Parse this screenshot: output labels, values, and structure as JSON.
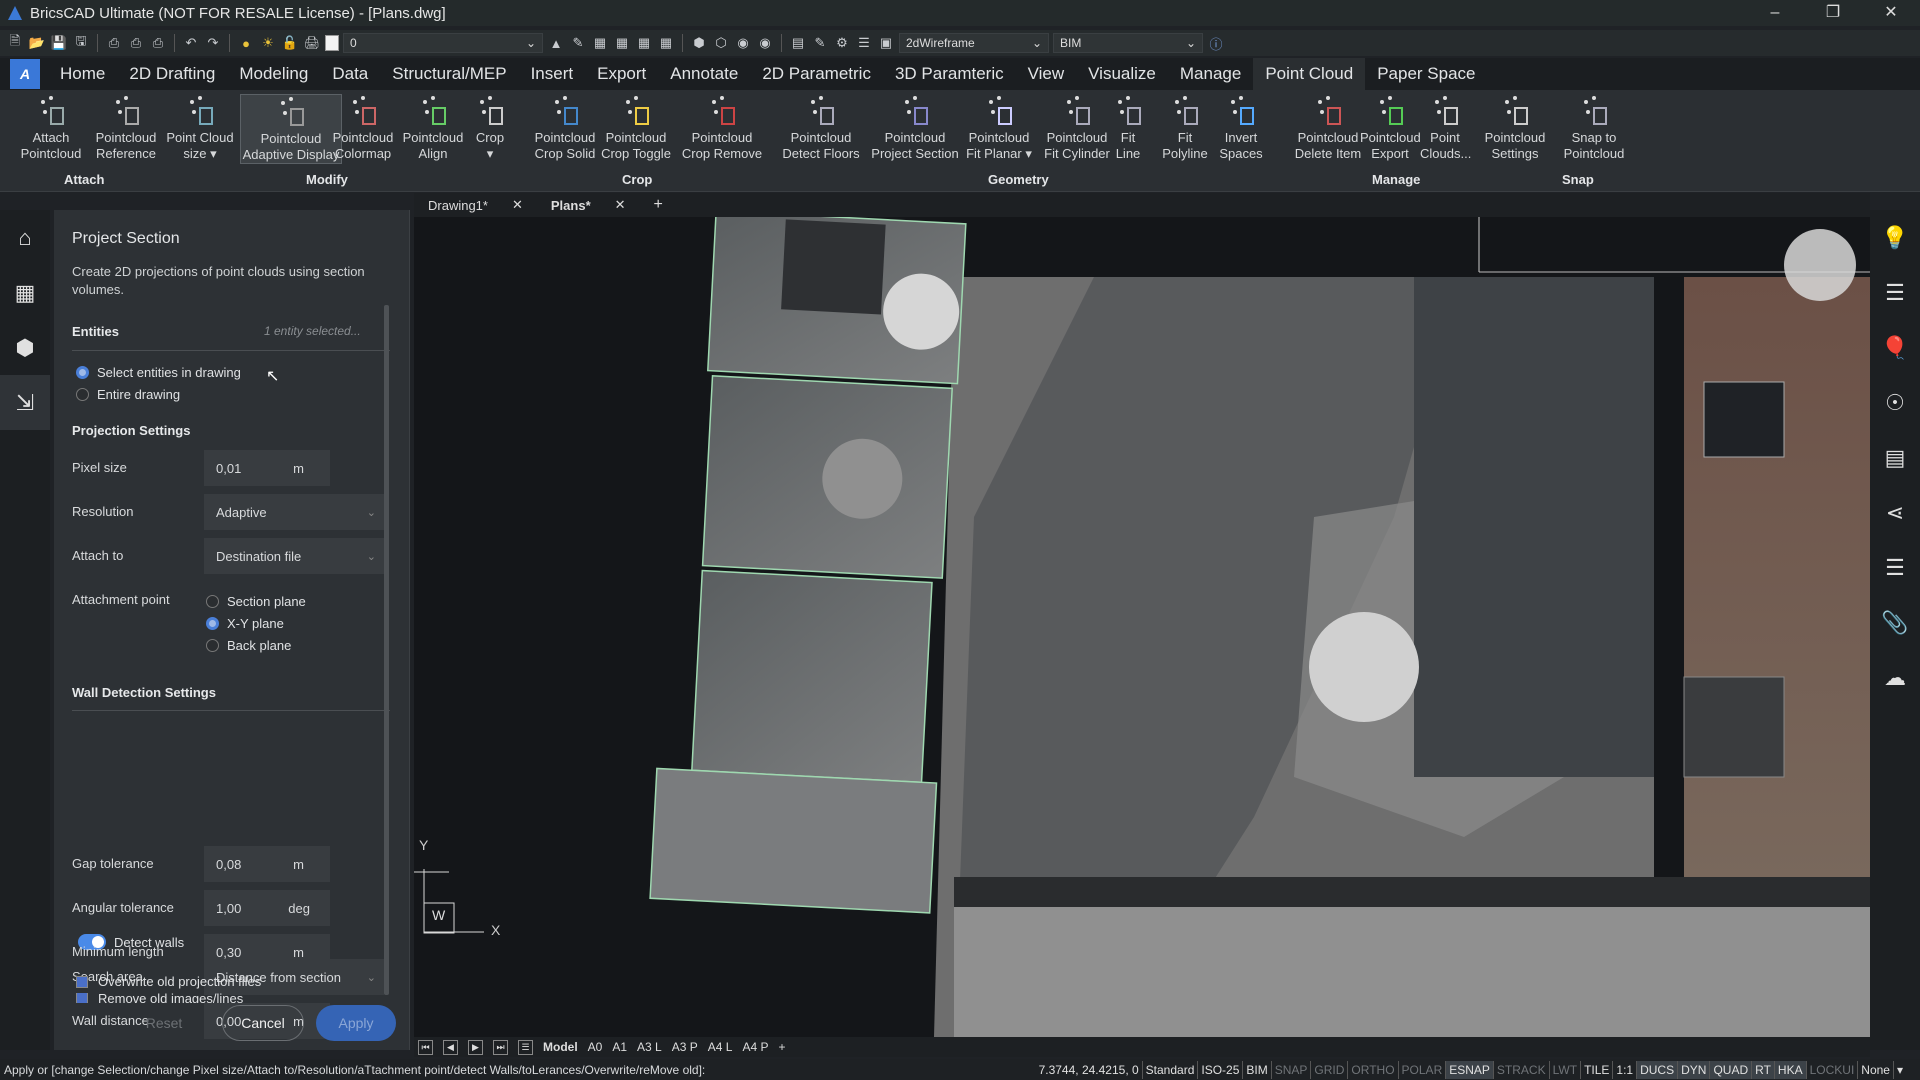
{
  "window": {
    "title": "BricsCAD Ultimate (NOT FOR RESALE License) - [Plans.dwg]",
    "controls": [
      "minimize",
      "restore",
      "close"
    ]
  },
  "quick_access": {
    "layer_value": "0",
    "visual_style": "2dWireframe",
    "workspace": "BIM",
    "icons": [
      "new-icon",
      "open-icon",
      "save-icon",
      "save-as-icon",
      "plot-icon",
      "plot-preview-icon",
      "publish-icon",
      "undo-icon",
      "redo-icon",
      "layer-on-icon",
      "layer-freeze-icon",
      "layer-lock-icon",
      "layer-print-icon"
    ]
  },
  "menu": {
    "logo": "A",
    "tabs": [
      "Home",
      "2D Drafting",
      "Modeling",
      "Data",
      "Structural/MEP",
      "Insert",
      "Export",
      "Annotate",
      "2D Parametric",
      "3D Paramteric",
      "View",
      "Visualize",
      "Manage",
      "Point Cloud",
      "Paper Space"
    ],
    "active_tab": "Point Cloud"
  },
  "ribbon": {
    "buttons": [
      {
        "l1": "Attach",
        "l2": "Pointcloud"
      },
      {
        "l1": "Pointcloud",
        "l2": "Reference"
      },
      {
        "l1": "Point Cloud",
        "l2": "size ▾"
      },
      {
        "l1": "Pointcloud",
        "l2": "Adaptive Display"
      },
      {
        "l1": "Pointcloud",
        "l2": "Colormap"
      },
      {
        "l1": "Pointcloud",
        "l2": "Align"
      },
      {
        "l1": "Crop",
        "l2": "▾"
      },
      {
        "l1": "Pointcloud",
        "l2": "Crop Solid"
      },
      {
        "l1": "Pointcloud",
        "l2": "Crop Toggle"
      },
      {
        "l1": "Pointcloud",
        "l2": "Crop Remove"
      },
      {
        "l1": "Pointcloud",
        "l2": "Detect Floors"
      },
      {
        "l1": "Pointcloud",
        "l2": "Project Section"
      },
      {
        "l1": "Pointcloud",
        "l2": "Fit Planar ▾"
      },
      {
        "l1": "Pointcloud",
        "l2": "Fit Cylinder"
      },
      {
        "l1": "Fit",
        "l2": "Line"
      },
      {
        "l1": "Fit",
        "l2": "Polyline"
      },
      {
        "l1": "Invert",
        "l2": "Spaces"
      },
      {
        "l1": "Pointcloud",
        "l2": "Delete Item"
      },
      {
        "l1": "Pointcloud",
        "l2": "Export"
      },
      {
        "l1": "Point",
        "l2": "Clouds..."
      },
      {
        "l1": "Pointcloud",
        "l2": "Settings"
      },
      {
        "l1": "Snap to",
        "l2": "Pointcloud"
      }
    ],
    "groups": [
      "Attach",
      "Modify",
      "Crop",
      "Geometry",
      "Manage",
      "Snap"
    ]
  },
  "panel": {
    "title": "Project Section",
    "description": "Create 2D projections of point clouds using section volumes.",
    "entities": {
      "label": "Entities",
      "status": "1 entity selected...",
      "options": [
        "Select entities in drawing",
        "Entire drawing"
      ],
      "selected": 0
    },
    "projection": {
      "label": "Projection Settings",
      "pixel_size": {
        "label": "Pixel size",
        "value": "0,01",
        "unit": "m"
      },
      "resolution": {
        "label": "Resolution",
        "value": "Adaptive"
      },
      "attach_to": {
        "label": "Attach to",
        "value": "Destination file"
      },
      "attachment_point": {
        "label": "Attachment point",
        "options": [
          "Section plane",
          "X-Y plane",
          "Back plane"
        ],
        "selected": 1
      }
    },
    "wall_detection": {
      "label": "Wall Detection Settings",
      "detect_walls": {
        "label": "Detect walls",
        "enabled": true
      },
      "search_area": {
        "label": "Search area",
        "value": "Distance from section"
      },
      "wall_distance": {
        "label": "Wall distance",
        "value": "0,00",
        "unit": "m"
      },
      "gap_tolerance": {
        "label": "Gap tolerance",
        "value": "0,08",
        "unit": "m"
      },
      "angular_tolerance": {
        "label": "Angular tolerance",
        "value": "1,00",
        "unit": "deg"
      },
      "minimum_length": {
        "label": "Minimum length",
        "value": "0,30",
        "unit": "m"
      }
    },
    "checkboxes": [
      {
        "label": "Overwrite old projection files",
        "checked": true
      },
      {
        "label": "Remove old images/lines",
        "checked": true
      }
    ],
    "buttons": {
      "reset": "Reset",
      "cancel": "Cancel",
      "apply": "Apply"
    }
  },
  "doc_tabs": [
    {
      "label": "Drawing1*",
      "active": false
    },
    {
      "label": "Plans*",
      "active": true
    }
  ],
  "viewport": {
    "ucs": {
      "y": "Y",
      "x": "X",
      "w": "W"
    }
  },
  "layout_tabs": [
    "Model",
    "A0",
    "A1",
    "A3 L",
    "A3 P",
    "A4 L",
    "A4 P",
    "+"
  ],
  "command_line": "Apply or [change Selection/change Pixel size/Attach to/Resolution/aTtachment point/detect Walls/toLerances/Overwrite/reMove old]:",
  "status": {
    "coords": "7.3744, 24.4215, 0",
    "items": [
      {
        "t": "Standard",
        "s": "normal"
      },
      {
        "t": "ISO-25",
        "s": "normal"
      },
      {
        "t": "BIM",
        "s": "normal"
      },
      {
        "t": "SNAP",
        "s": "off"
      },
      {
        "t": "GRID",
        "s": "off"
      },
      {
        "t": "ORTHO",
        "s": "off"
      },
      {
        "t": "POLAR",
        "s": "off"
      },
      {
        "t": "ESNAP",
        "s": "on"
      },
      {
        "t": "STRACK",
        "s": "off"
      },
      {
        "t": "LWT",
        "s": "off"
      },
      {
        "t": "TILE",
        "s": "normal"
      },
      {
        "t": "1:1",
        "s": "normal"
      },
      {
        "t": "DUCS",
        "s": "on"
      },
      {
        "t": "DYN",
        "s": "on"
      },
      {
        "t": "QUAD",
        "s": "on"
      },
      {
        "t": "RT",
        "s": "on"
      },
      {
        "t": "HKA",
        "s": "on"
      },
      {
        "t": "LOCKUI",
        "s": "off"
      },
      {
        "t": "None",
        "s": "normal"
      }
    ]
  }
}
